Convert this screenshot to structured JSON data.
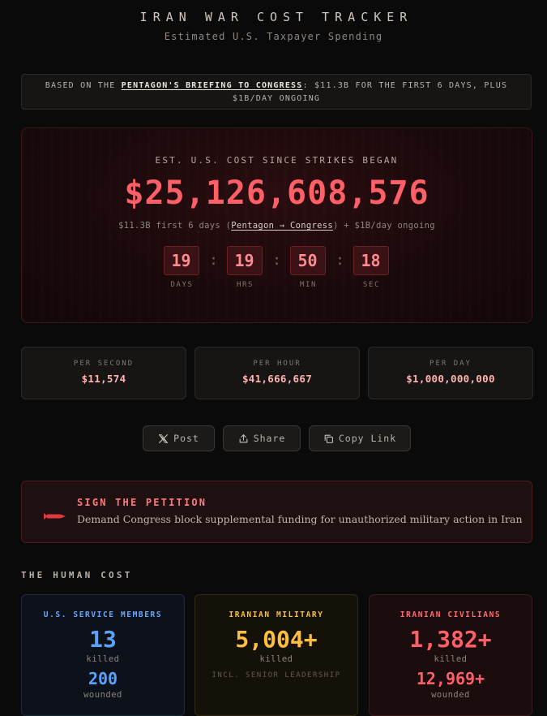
{
  "header": {
    "title": "IRAN WAR COST TRACKER",
    "subtitle": "Estimated U.S. Taxpayer Spending"
  },
  "source_banner": {
    "prefix": "BASED ON THE ",
    "link": "PENTAGON'S BRIEFING TO CONGRESS",
    "suffix": ": $11.3B FOR THE FIRST 6 DAYS, PLUS $1B/DAY ONGOING"
  },
  "main": {
    "label": "EST. U.S. COST SINCE STRIKES BEGAN",
    "amount": "$25,126,608,576",
    "note_prefix": "$11.3B first 6 days (",
    "note_link": "Pentagon → Congress",
    "note_suffix": ") + $1B/day ongoing",
    "timer": [
      {
        "value": "19",
        "label": "DAYS"
      },
      {
        "value": "19",
        "label": "HRS"
      },
      {
        "value": "50",
        "label": "MIN"
      },
      {
        "value": "18",
        "label": "SEC"
      }
    ],
    "separator": ":"
  },
  "rates": [
    {
      "label": "PER SECOND",
      "value": "$11,574"
    },
    {
      "label": "PER HOUR",
      "value": "$41,666,667"
    },
    {
      "label": "PER DAY",
      "value": "$1,000,000,000"
    }
  ],
  "actions": {
    "post": "Post",
    "share": "Share",
    "copy": "Copy Link"
  },
  "petition": {
    "title": "SIGN THE PETITION",
    "description": "Demand Congress block supplemental funding for unauthorized military action in Iran",
    "icon": "missile-icon"
  },
  "human_cost": {
    "section_title": "THE HUMAN COST",
    "us": {
      "title": "U.S. SERVICE MEMBERS",
      "killed": "13",
      "killed_label": "killed",
      "wounded": "200",
      "wounded_label": "wounded",
      "color": "#5aa2ff"
    },
    "iran_military": {
      "title": "IRANIAN MILITARY",
      "killed": "5,004+",
      "killed_label": "killed",
      "note": "INCL. SENIOR LEADERSHIP",
      "color": "#ffbf3c"
    },
    "iran_civilians": {
      "title": "IRANIAN CIVILIANS",
      "killed": "1,382+",
      "killed_label": "killed",
      "wounded": "12,969+",
      "wounded_label": "wounded",
      "color": "#ff5f66"
    }
  },
  "colors": {
    "background": "#0b0a0a",
    "accent_red": "#ff5f66",
    "timer_text": "#ff8a8f"
  }
}
